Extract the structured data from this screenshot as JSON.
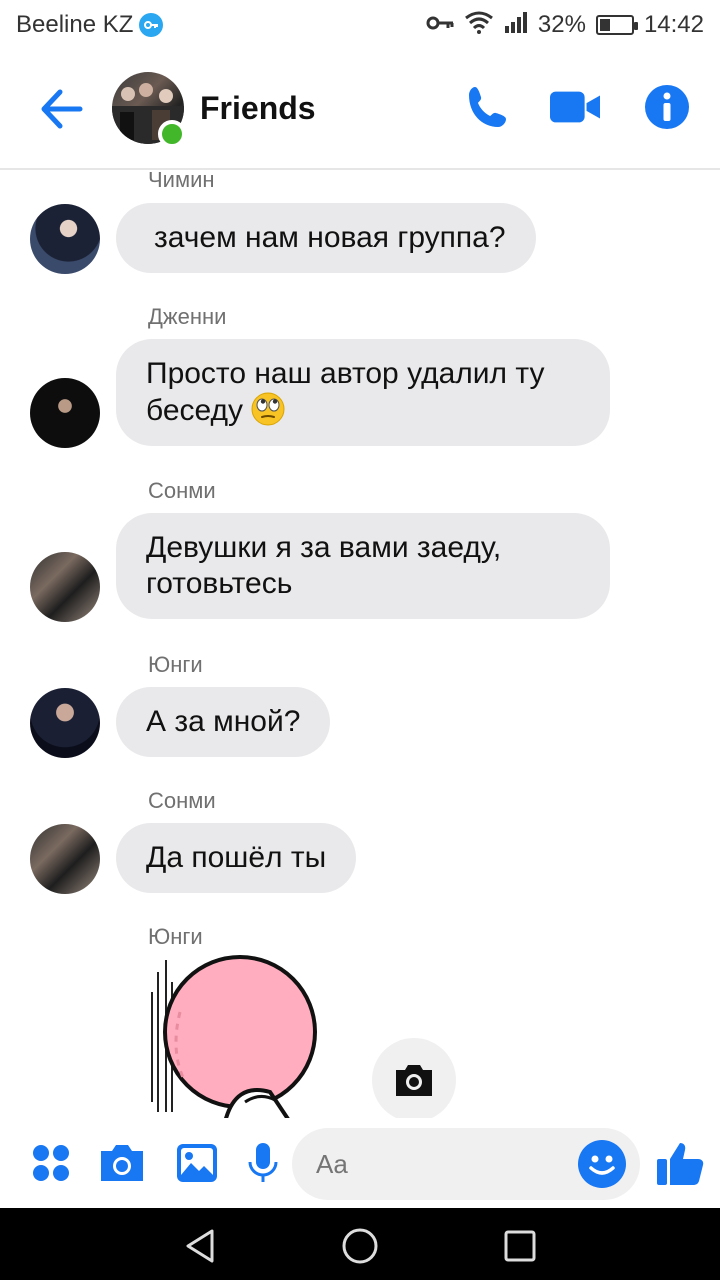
{
  "status": {
    "carrier": "Beeline KZ",
    "battery_text": "32%",
    "battery_level": 0.32,
    "time": "14:42",
    "icons": [
      "vpn-key-icon",
      "key-icon",
      "wifi-icon",
      "signal-icon",
      "battery-icon"
    ]
  },
  "header": {
    "title": "Friends",
    "icons": [
      "back-arrow-icon",
      "phone-icon",
      "video-camera-icon",
      "info-icon"
    ],
    "accent": "#1877f2",
    "online_color": "#42b72a"
  },
  "messages": [
    {
      "sender": "Чимин",
      "text": "зачем нам новая группа?"
    },
    {
      "sender": "Дженни",
      "text_line1": "Просто наш автор удалил ту",
      "text_line2": "беседу",
      "emoji": "face-with-rolling-eyes"
    },
    {
      "sender": "Сонми",
      "text_line1": "Девушки я за вами заеду,",
      "text_line2": "готовьтесь"
    },
    {
      "sender": "Юнги",
      "text": "А за мной?"
    },
    {
      "sender": "Сонми",
      "text": "Да пошёл ты"
    },
    {
      "sender": "Юнги",
      "sticker": "pink-character-sticker"
    }
  ],
  "composer": {
    "placeholder": "Aa",
    "icons": [
      "apps-icon",
      "camera-icon",
      "gallery-icon",
      "microphone-icon",
      "emoji-icon",
      "thumbs-up-icon"
    ]
  },
  "bubble_color": "#e9e9eb",
  "navbar": {
    "icons": [
      "back-triangle-icon",
      "home-circle-icon",
      "recents-square-icon"
    ]
  }
}
